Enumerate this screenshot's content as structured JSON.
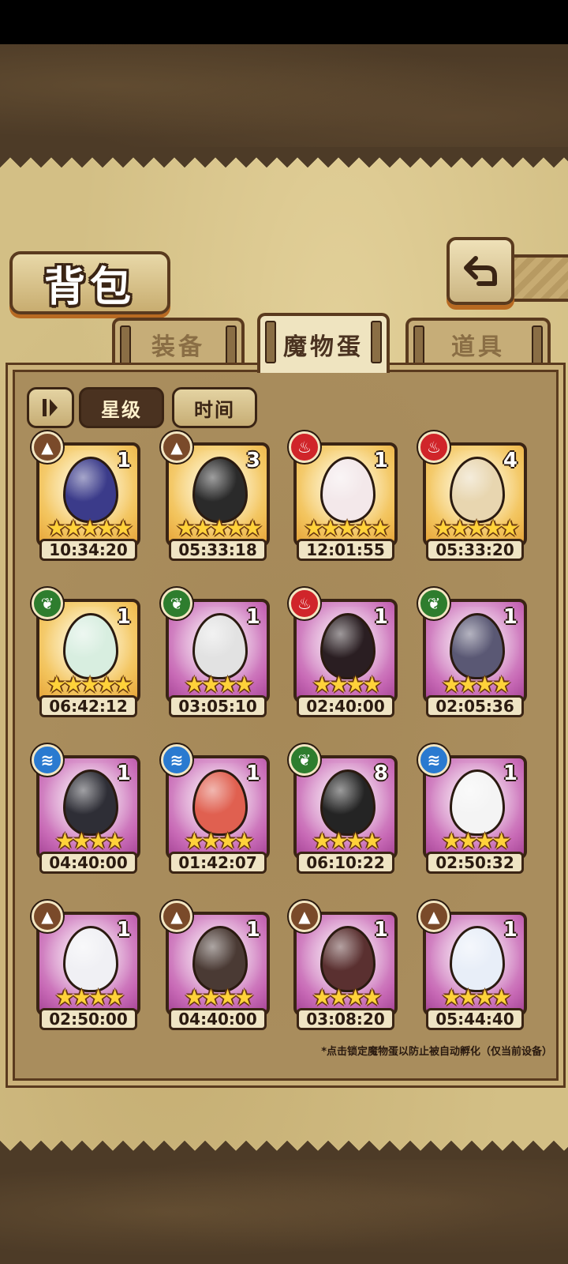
{
  "title": "背包",
  "tabs": [
    {
      "label": "装备",
      "active": false
    },
    {
      "label": "魔物蛋",
      "active": true
    },
    {
      "label": "道具",
      "active": false
    }
  ],
  "filters": {
    "sort_toggle_icon": "sort-toggle-icon",
    "star_label": "星级",
    "time_label": "时间",
    "active": "星级"
  },
  "eggs": [
    {
      "element": "earth",
      "count": "1",
      "stars": 5,
      "rarity": "gold",
      "timer": "10:34:20",
      "color": "#3b3b8a"
    },
    {
      "element": "earth",
      "count": "3",
      "stars": 5,
      "rarity": "gold",
      "timer": "05:33:18",
      "color": "#2a2a2a"
    },
    {
      "element": "fire",
      "count": "1",
      "stars": 5,
      "rarity": "gold",
      "timer": "12:01:55",
      "color": "#f3e8ea"
    },
    {
      "element": "fire",
      "count": "4",
      "stars": 5,
      "rarity": "gold",
      "timer": "05:33:20",
      "color": "#e8d6b0"
    },
    {
      "element": "nature",
      "count": "1",
      "stars": 5,
      "rarity": "gold",
      "timer": "06:42:12",
      "color": "#d8eee0"
    },
    {
      "element": "nature",
      "count": "1",
      "stars": 4,
      "rarity": "purple",
      "timer": "03:05:10",
      "color": "#e2e2e2"
    },
    {
      "element": "fire",
      "count": "1",
      "stars": 4,
      "rarity": "purple",
      "timer": "02:40:00",
      "color": "#2a1e22"
    },
    {
      "element": "nature",
      "count": "1",
      "stars": 4,
      "rarity": "purple",
      "timer": "02:05:36",
      "color": "#5a5874"
    },
    {
      "element": "water",
      "count": "1",
      "stars": 4,
      "rarity": "purple",
      "timer": "04:40:00",
      "color": "#2e2e36"
    },
    {
      "element": "water",
      "count": "1",
      "stars": 4,
      "rarity": "purple",
      "timer": "01:42:07",
      "color": "#e06050"
    },
    {
      "element": "nature",
      "count": "8",
      "stars": 4,
      "rarity": "purple",
      "timer": "06:10:22",
      "color": "#242424"
    },
    {
      "element": "water",
      "count": "1",
      "stars": 4,
      "rarity": "purple",
      "timer": "02:50:32",
      "color": "#f4f4f4"
    },
    {
      "element": "earth",
      "count": "1",
      "stars": 4,
      "rarity": "purple",
      "timer": "02:50:00",
      "color": "#f0f0f4"
    },
    {
      "element": "earth",
      "count": "1",
      "stars": 4,
      "rarity": "purple",
      "timer": "04:40:00",
      "color": "#4a3a34"
    },
    {
      "element": "earth",
      "count": "1",
      "stars": 4,
      "rarity": "purple",
      "timer": "03:08:20",
      "color": "#5a3030"
    },
    {
      "element": "earth",
      "count": "1",
      "stars": 4,
      "rarity": "purple",
      "timer": "05:44:40",
      "color": "#e8eef8"
    }
  ],
  "element_colors": {
    "earth": "#7a4a2a",
    "fire": "#d0252a",
    "nature": "#2e7d2e",
    "water": "#2a7ad0"
  },
  "element_glyphs": {
    "earth": "▲",
    "fire": "♨",
    "nature": "❦",
    "water": "≋"
  },
  "footnote": "*点击锁定魔物蛋以防止被自动孵化（仅当前设备）"
}
